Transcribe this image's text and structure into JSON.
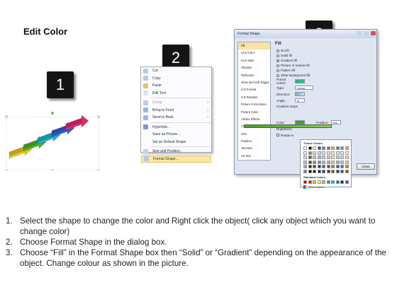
{
  "title": "Edit Color",
  "steps": [
    "1",
    "2",
    "3"
  ],
  "context_menu": {
    "items": [
      {
        "label": "Cut",
        "icon": "scissors-icon",
        "color": "#c0c8d8"
      },
      {
        "label": "Copy",
        "icon": "copy-icon",
        "color": "#b9c9e2"
      },
      {
        "label": "Paste",
        "icon": "paste-icon",
        "color": "#e0c27a"
      },
      {
        "label": "Edit Text",
        "icon": "edit-text-icon",
        "color": "#d9e2f0"
      },
      {
        "label": "Group",
        "icon": "group-icon",
        "color": "#c8ccd4",
        "arrow": "›",
        "disabled": true
      },
      {
        "label": "Bring to Front",
        "icon": "bring-front-icon",
        "color": "#9fb6dc",
        "arrow": "›"
      },
      {
        "label": "Send to Back",
        "icon": "send-back-icon",
        "color": "#9fb6dc",
        "arrow": "›"
      },
      {
        "label": "Hyperlink...",
        "icon": "hyperlink-icon",
        "color": "#7a9ad0"
      },
      {
        "label": "Save as Picture...",
        "icon": "",
        "color": "transparent"
      },
      {
        "label": "Set as Default Shape",
        "icon": "",
        "color": "transparent"
      },
      {
        "label": "Size and Position...",
        "icon": "size-icon",
        "color": "#c8d2e2"
      },
      {
        "label": "Format Shape...",
        "icon": "format-shape-icon",
        "color": "#b8c8e8",
        "highlight": true
      }
    ]
  },
  "dialog": {
    "title": "Format Shape",
    "categories": [
      "Fill",
      "Line Color",
      "Line Style",
      "Shadow",
      "Reflection",
      "Glow and Soft Edges",
      "3-D Format",
      "3-D Rotation",
      "Picture Corrections",
      "Picture Color",
      "Artistic Effects",
      "Crop",
      "Size",
      "Position",
      "Text Box",
      "Alt Text"
    ],
    "active_category": "Fill",
    "heading": "Fill",
    "fill_options": [
      "No fill",
      "Solid fill",
      "Gradient fill",
      "Picture or texture fill",
      "Pattern fill",
      "Slide background fill"
    ],
    "selected_fill": "Gradient fill",
    "preset_colors_label": "Preset colors:",
    "type_label": "Type:",
    "type_value": "Linear",
    "direction_label": "Direction:",
    "angle_label": "Angle:",
    "angle_value": "0°",
    "gradient_stops_label": "Gradient stops",
    "color_label": "Color",
    "position_label": "Position:",
    "position_value": "0%",
    "brightness_label": "Brightness",
    "rotate_label": "Rotate w",
    "close_label": "Close"
  },
  "palette": {
    "theme_label": "Theme Colors",
    "standard_label": "Standard Colors",
    "more_label": "More Colors...",
    "theme_row": [
      "#ffffff",
      "#000000",
      "#eeece1",
      "#1f497d",
      "#4f81bd",
      "#c0504d",
      "#9bbb59",
      "#8064a2",
      "#4bacc6",
      "#f79646"
    ],
    "shade_rows": [
      [
        "#f2f2f2",
        "#7f7f7f",
        "#ddd9c3",
        "#c6d9f0",
        "#dbe5f1",
        "#f2dcdb",
        "#ebf1dd",
        "#e5e0ec",
        "#dbeef3",
        "#fdeada"
      ],
      [
        "#d8d8d8",
        "#595959",
        "#c4bd97",
        "#8db3e2",
        "#b8cce4",
        "#e5b9b7",
        "#d7e3bc",
        "#ccc1d9",
        "#b7dde8",
        "#fbd5b5"
      ],
      [
        "#bfbfbf",
        "#3f3f3f",
        "#938953",
        "#548dd4",
        "#95b3d7",
        "#d99694",
        "#c3d69b",
        "#b2a2c7",
        "#92cddc",
        "#fac08f"
      ],
      [
        "#a5a5a5",
        "#262626",
        "#494429",
        "#17365d",
        "#366092",
        "#953734",
        "#76923c",
        "#5f497a",
        "#31859b",
        "#e36c09"
      ],
      [
        "#7f7f7f",
        "#0c0c0c",
        "#1d1b10",
        "#0f243e",
        "#244061",
        "#632423",
        "#4f6128",
        "#3f3151",
        "#205867",
        "#974806"
      ]
    ],
    "standard_row": [
      "#c00000",
      "#ff0000",
      "#ffc000",
      "#ffff00",
      "#92d050",
      "#00b050",
      "#00b0f0",
      "#0070c0",
      "#002060",
      "#7030a0"
    ]
  },
  "arrows": [
    {
      "name": "yellow-arrow",
      "color": "#e9c21b"
    },
    {
      "name": "green-arrow",
      "color": "#4bb22a"
    },
    {
      "name": "cyan-arrow",
      "color": "#21b3c6"
    },
    {
      "name": "blue-arrow",
      "color": "#2f5fc8"
    },
    {
      "name": "pink-arrow",
      "color": "#e0286f"
    }
  ],
  "instructions": [
    {
      "num": "1.",
      "text": "Select the shape to change the color and Right click the object( click any object which you want to change color)"
    },
    {
      "num": "2.",
      "text": "Choose Format Shape in the dialog box."
    },
    {
      "num": "3.",
      "text": "Choose “Fill” in the Format Shape box then “Solid” or “Gradient” depending on the appearance of the object. Change colour as shown in the picture."
    }
  ]
}
